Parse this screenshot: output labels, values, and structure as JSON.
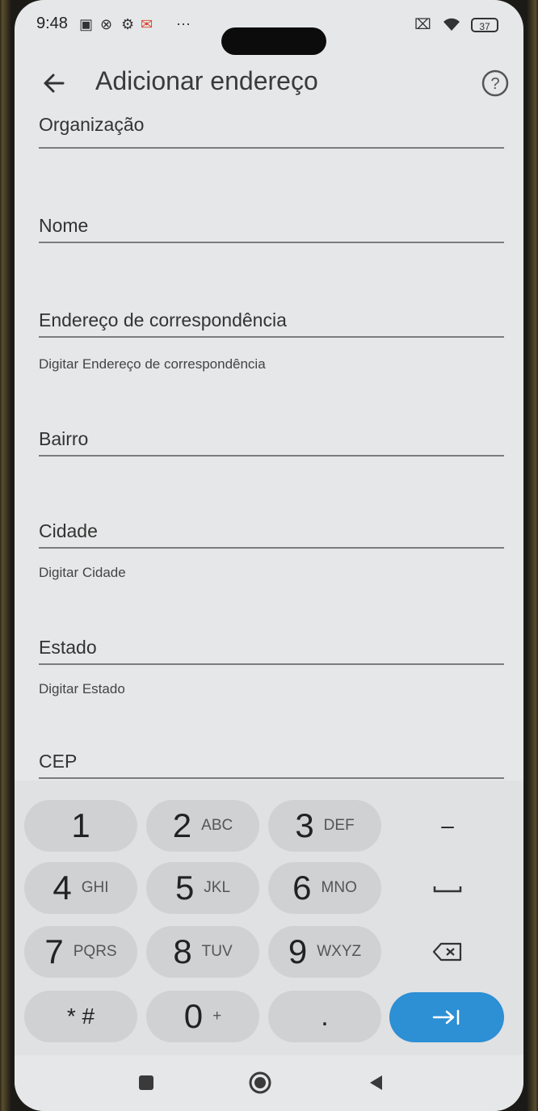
{
  "status": {
    "time": "9:48",
    "battery": "37"
  },
  "header": {
    "title": "Adicionar endereço"
  },
  "form": {
    "organizacao": "Organização",
    "nome": "Nome",
    "endereco": "Endereço de correspondência",
    "endereco_hint": "Digitar Endereço de correspondência",
    "bairro": "Bairro",
    "cidade": "Cidade",
    "cidade_hint": "Digitar Cidade",
    "estado": "Estado",
    "estado_hint": "Digitar Estado",
    "cep": "CEP"
  },
  "keyboard": {
    "k1": "1",
    "k2": "2",
    "k2_sub": "ABC",
    "k3": "3",
    "k3_sub": "DEF",
    "k4": "4",
    "k4_sub": "GHI",
    "k5": "5",
    "k5_sub": "JKL",
    "k6": "6",
    "k6_sub": "MNO",
    "k7": "7",
    "k7_sub": "PQRS",
    "k8": "8",
    "k8_sub": "TUV",
    "k9": "9",
    "k9_sub": "WXYZ",
    "star_hash": "* #",
    "k0": "0",
    "k0_sub": "+",
    "dot": ".",
    "minus": "–"
  },
  "icons": {
    "back": "back-arrow-icon",
    "help": "help-circle-icon",
    "space": "space-icon",
    "delete": "backspace-icon",
    "enter": "next-field-icon",
    "nav_recents": "recents-square-icon",
    "nav_home": "home-circle-icon",
    "nav_back": "back-triangle-icon"
  },
  "colors": {
    "enter": "#2d8fd4",
    "background": "#e6e7e8",
    "key": "#d0d1d3"
  }
}
